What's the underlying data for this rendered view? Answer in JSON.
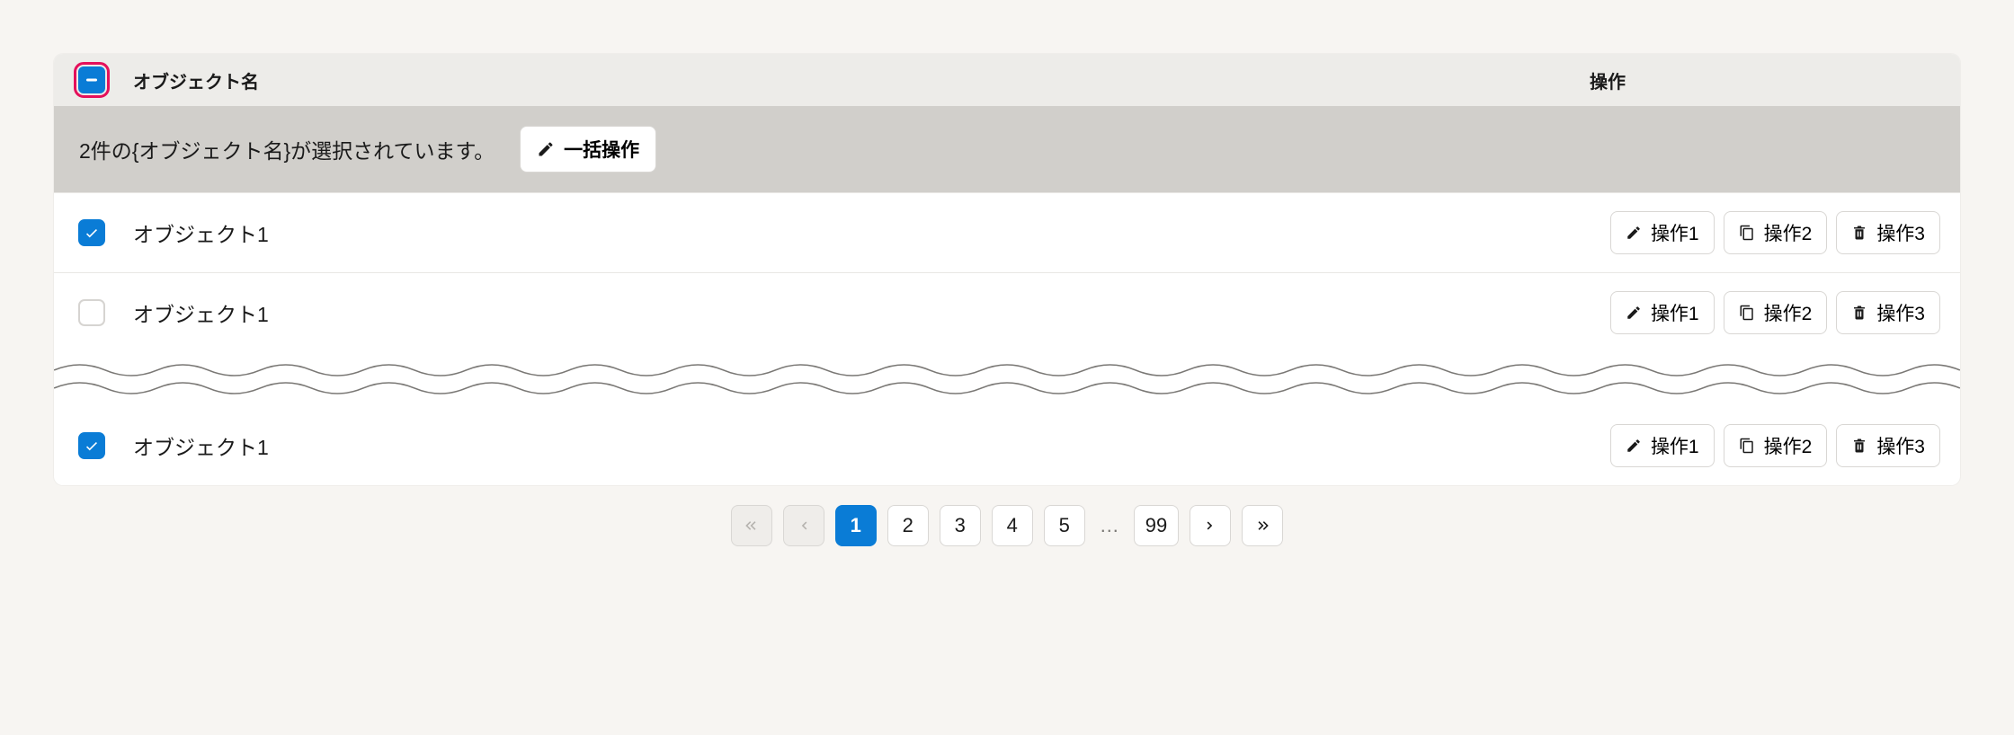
{
  "header": {
    "name_label": "オブジェクト名",
    "ops_label": "操作"
  },
  "selection_bar": {
    "text": "2件の{オブジェクト名}が選択されています。",
    "bulk_label": "一括操作"
  },
  "action_labels": {
    "op1": "操作1",
    "op2": "操作2",
    "op3": "操作3"
  },
  "rows": [
    {
      "checked": true,
      "name": "オブジェクト1"
    },
    {
      "checked": false,
      "name": "オブジェクト1"
    },
    {
      "checked": true,
      "name": "オブジェクト1"
    }
  ],
  "pagination": {
    "first_disabled": true,
    "prev_disabled": true,
    "pages": [
      "1",
      "2",
      "3",
      "4",
      "5"
    ],
    "active": "1",
    "ellipsis": "…",
    "last_page": "99"
  }
}
